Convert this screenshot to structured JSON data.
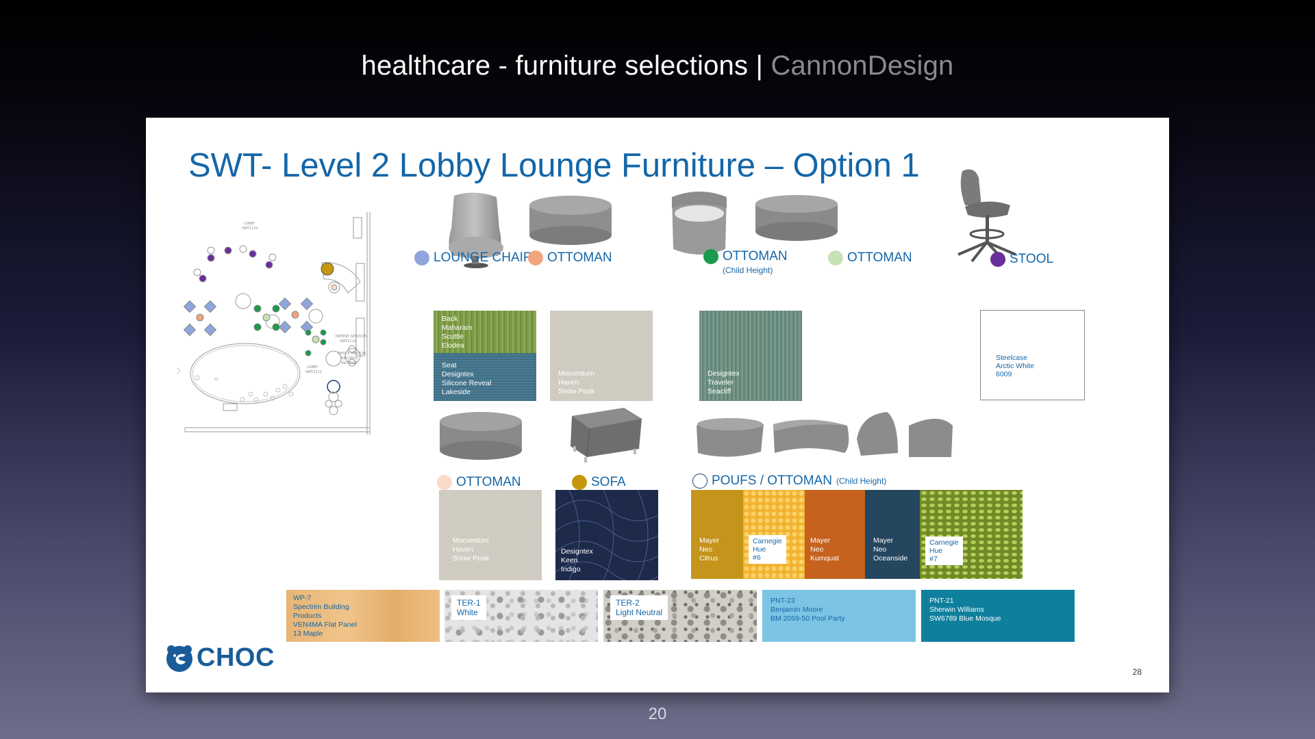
{
  "header": {
    "title": "healthcare - furniture selections",
    "separator": "|",
    "brand": "CannonDesign"
  },
  "footer": {
    "page_number": "20"
  },
  "slide": {
    "title": "SWT- Level 2 Lobby Lounge Furniture – Option 1",
    "slide_number": "28",
    "logo_text": "CHOC",
    "items": {
      "lounge_chair": {
        "label": "LOUNGE CHAIR",
        "color": "#8fa6dc"
      },
      "ottoman_orange": {
        "label": "OTTOMAN",
        "color": "#f2a47c"
      },
      "ottoman_child": {
        "label": "OTTOMAN",
        "sublabel": "(Child Height)",
        "color": "#1a9a4c"
      },
      "ottoman_light_green": {
        "label": "OTTOMAN",
        "color": "#c6e2b6"
      },
      "stool": {
        "label": "STOOL",
        "color": "#6a2e9a"
      },
      "ottoman_peach": {
        "label": "OTTOMAN",
        "color": "#fbd9c9"
      },
      "sofa": {
        "label": "SOFA",
        "color": "#c4970e"
      },
      "poufs": {
        "label": "POUFS / OTTOMAN",
        "sublabel": "(Child Height)",
        "color": "#ffffff"
      }
    },
    "fabrics": {
      "back": [
        "Back",
        "Maharam",
        "Scuttle",
        "Elodea"
      ],
      "seat": [
        "Seat",
        "Designtex",
        "Silicone Reveal",
        "Lakeside"
      ],
      "momentum1": [
        "Momentum",
        "Haven",
        "Snow Peak"
      ],
      "designtex_traveler": [
        "Designtex",
        "Traveler",
        "Seacliff"
      ],
      "steelcase": [
        "Steelcase",
        "Arctic White",
        "6009"
      ],
      "momentum2": [
        "Momentum",
        "Haven",
        "Snow Peak"
      ],
      "designtex_keen": [
        "Designtex",
        "Keen",
        "Indigo"
      ],
      "mayer_citrus": [
        "Mayer",
        "Neo",
        "Citrus"
      ],
      "carnegie_6": [
        "Carnegie",
        "Hue",
        "#6"
      ],
      "mayer_kumquat": [
        "Mayer",
        "Neo",
        "Kumquat"
      ],
      "mayer_oceanside": [
        "Mayer",
        "Neo",
        "Oceanside"
      ],
      "carnegie_7": [
        "Carnegie",
        "Hue",
        "#7"
      ]
    },
    "finishes": {
      "wp7": [
        "WP-7",
        "Spectrim Building",
        "Products",
        "VEN4MA  Flat Panel",
        "13 Maple"
      ],
      "ter1": [
        "TER-1",
        "White"
      ],
      "ter2": [
        "TER-2",
        "Light Neutral"
      ],
      "pnt23": [
        "PNT-23",
        "Benjamin Moore",
        "BM 2059-50 Pool Party"
      ],
      "pnt21": [
        "PNT-21",
        "Sherwin Williams",
        "SW6789 Blue Mosque"
      ]
    },
    "plan_labels": {
      "lobby1": [
        "LOBBY",
        "SWT2110"
      ],
      "patient_services": [
        "PATIENT SERVICES",
        "SWT2112"
      ],
      "office_medical": [
        "OFFICE MEDICAL",
        "RECORDS",
        "SWT2113"
      ],
      "lobby2": [
        "LOBBY",
        "SWT2111"
      ]
    }
  }
}
